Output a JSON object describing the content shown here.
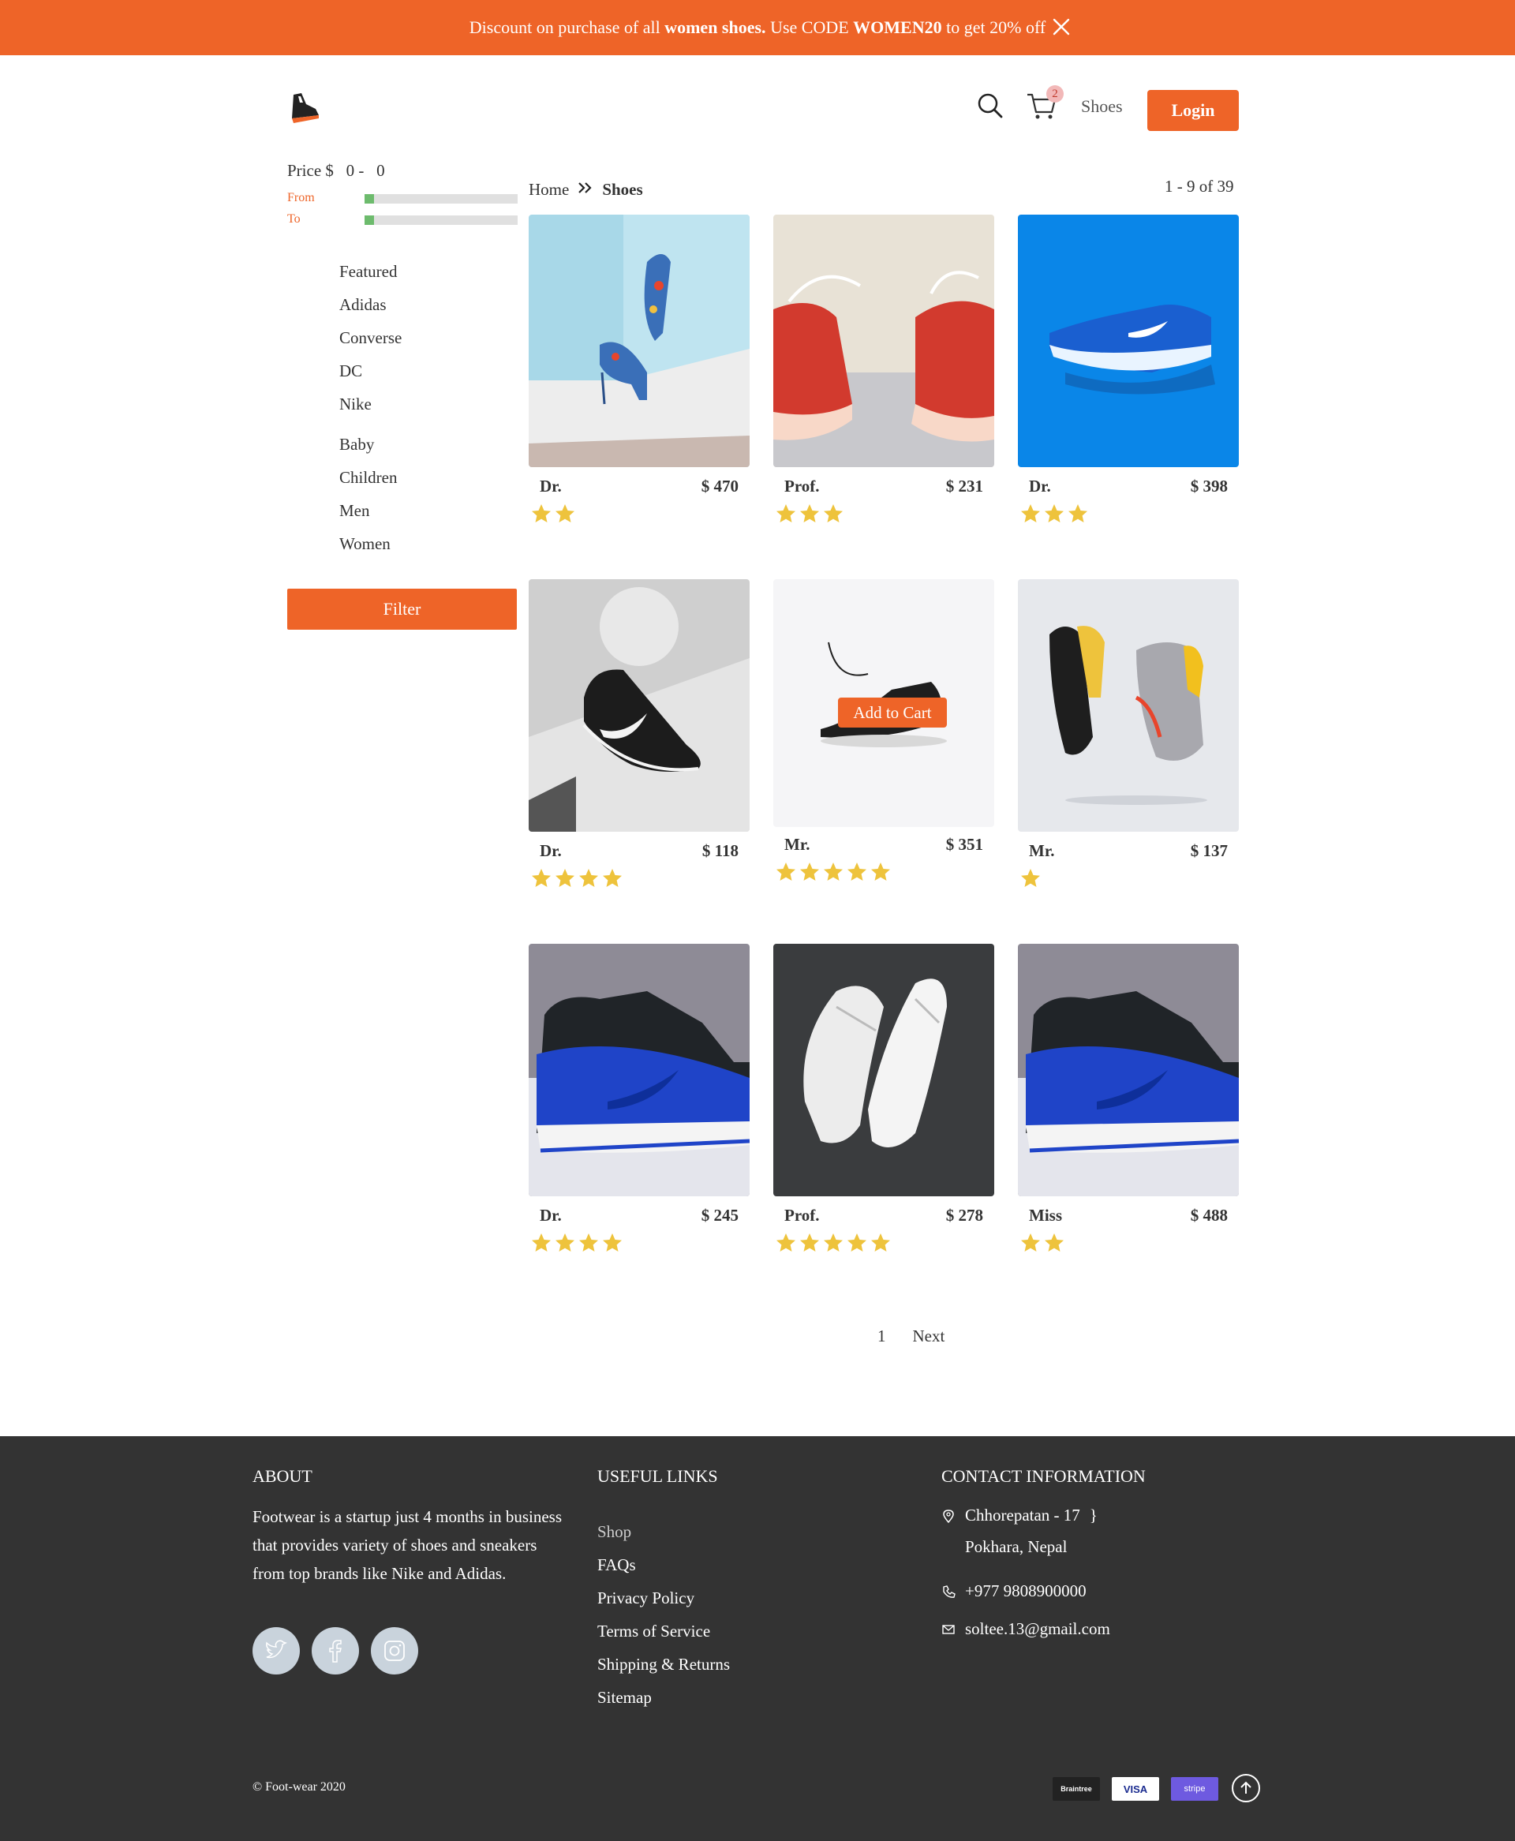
{
  "banner": {
    "text_1": "Discount on purchase of all ",
    "text_bold_1": "women shoes.",
    "text_2": " Use CODE ",
    "text_bold_2": "WOMEN20",
    "text_3": " to get 20% off"
  },
  "header": {
    "cart_count": "2",
    "shoes_link": "Shoes",
    "login_label": "Login"
  },
  "sidebar": {
    "price_label": "Price $",
    "price_from_value": "0",
    "price_separator": "-",
    "price_to_value": "0",
    "from_label": "From",
    "to_label": "To",
    "brands": [
      "Featured",
      "Adidas",
      "Converse",
      "DC",
      "Nike"
    ],
    "categories": [
      "Baby",
      "Children",
      "Men",
      "Women"
    ],
    "filter_label": "Filter"
  },
  "breadcrumb": {
    "home": "Home",
    "current": "Shoes"
  },
  "result_count": "1 - 9 of 39",
  "products": [
    {
      "title": "Dr.",
      "price": "$ 470",
      "rating": 2
    },
    {
      "title": "Prof.",
      "price": "$ 231",
      "rating": 3
    },
    {
      "title": "Dr.",
      "price": "$ 398",
      "rating": 3
    },
    {
      "title": "Dr.",
      "price": "$ 118",
      "rating": 4
    },
    {
      "title": "Mr.",
      "price": "$ 351",
      "rating": 5,
      "add_to_cart": "Add to Cart"
    },
    {
      "title": "Mr.",
      "price": "$ 137",
      "rating": 1
    },
    {
      "title": "Dr.",
      "price": "$ 245",
      "rating": 4
    },
    {
      "title": "Prof.",
      "price": "$ 278",
      "rating": 5
    },
    {
      "title": "Miss",
      "price": "$ 488",
      "rating": 2
    }
  ],
  "pagination": {
    "page": "1",
    "next": "Next"
  },
  "footer": {
    "about_title": "ABOUT",
    "about_text": "Footwear is a startup just 4 months in business that provides variety of shoes and sneakers from top brands like Nike and Adidas.",
    "links_title": "USEFUL LINKS",
    "links": [
      "Shop",
      "FAQs",
      "Privacy Policy",
      "Terms of Service",
      "Shipping & Returns",
      "Sitemap"
    ],
    "contact_title": "CONTACT INFORMATION",
    "address_line1": "Chhorepatan - 17",
    "address_line2": "Pokhara, Nepal",
    "phone": "+977 9808900000",
    "email": "soltee.13@gmail.com",
    "copyright": "© Foot-wear 2020",
    "payments": [
      "Braintree",
      "VISA",
      "stripe"
    ]
  },
  "colors": {
    "accent": "#ee6428",
    "star": "#eec33c",
    "footer_bg": "#333333",
    "slider_thumb": "#6dbb6d"
  },
  "icons": [
    "close-icon",
    "logo-shoe-icon",
    "search-icon",
    "cart-icon",
    "double-chevron-right-icon",
    "star-icon",
    "twitter-icon",
    "facebook-icon",
    "instagram-icon",
    "location-icon",
    "phone-icon",
    "mail-icon",
    "arrow-up-icon"
  ]
}
